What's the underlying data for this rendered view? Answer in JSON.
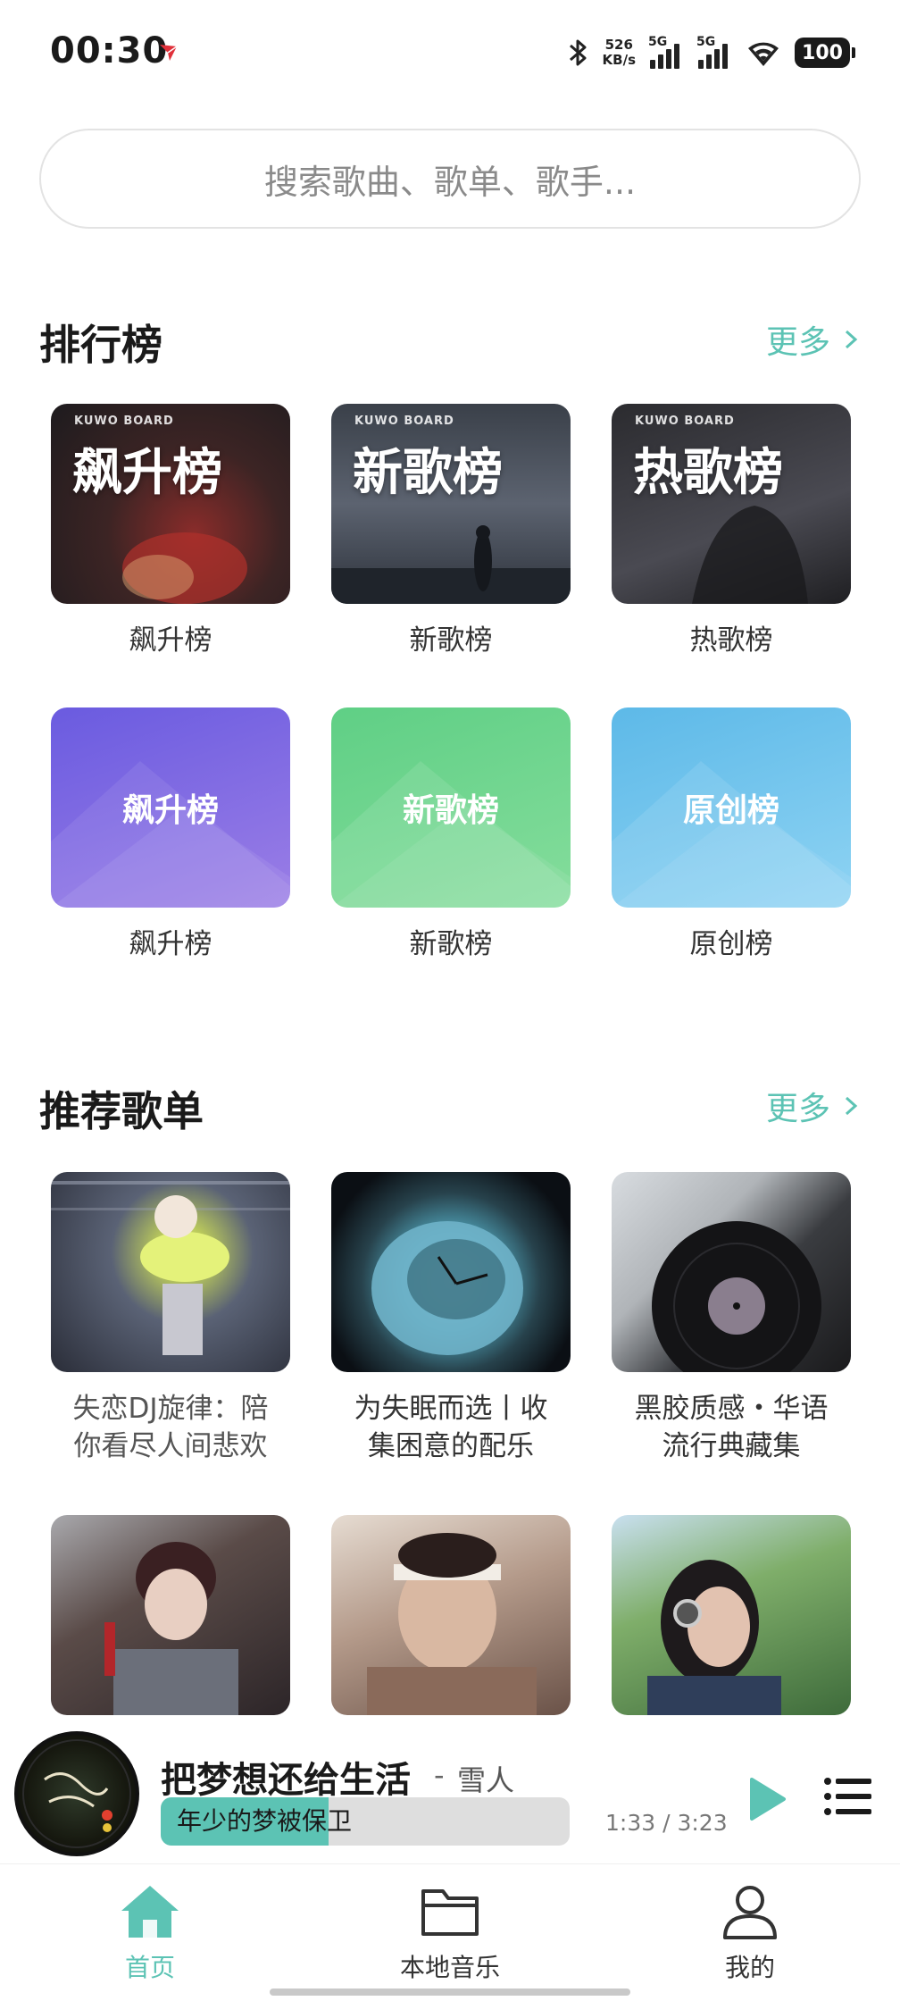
{
  "status_bar": {
    "time": "00:30",
    "net_speed_value": "526",
    "net_speed_unit": "KB/s",
    "signal1_label": "5G",
    "signal2_label": "5G",
    "battery": "100",
    "icons": [
      "bluetooth-icon",
      "signal-icon",
      "wifi-icon",
      "battery-icon"
    ]
  },
  "search": {
    "placeholder": "搜索歌曲、歌单、歌手..."
  },
  "charts_section": {
    "title": "排行榜",
    "more": "更多",
    "tiles": [
      {
        "cover_label": "飙升榜",
        "brand": "KUWO BOARD",
        "caption": "飙升榜"
      },
      {
        "cover_label": "新歌榜",
        "brand": "KUWO BOARD",
        "caption": "新歌榜"
      },
      {
        "cover_label": "热歌榜",
        "brand": "KUWO BOARD",
        "caption": "热歌榜"
      },
      {
        "cover_label": "飙升榜",
        "caption": "飙升榜"
      },
      {
        "cover_label": "新歌榜",
        "caption": "新歌榜"
      },
      {
        "cover_label": "原创榜",
        "caption": "原创榜"
      }
    ]
  },
  "playlists_section": {
    "title": "推荐歌单",
    "more": "更多",
    "items": [
      {
        "line1": "失恋DJ旋律：陪",
        "line2": "你看尽人间悲欢"
      },
      {
        "line1": "为失眠而选丨收",
        "line2": "集困意的配乐"
      },
      {
        "line1": "黑胶质感・华语",
        "line2": "流行典藏集"
      },
      {
        "line1": "",
        "line2": ""
      },
      {
        "line1": "",
        "line2": ""
      },
      {
        "line1": "",
        "line2": ""
      }
    ]
  },
  "player": {
    "song": "把梦想还给生活",
    "separator": "-",
    "artist": "雪人",
    "lyric": "年少的梦被保卫",
    "progress_fraction": 0.41,
    "time": "1:33 / 3:23"
  },
  "bottom_nav": {
    "home": "首页",
    "local": "本地音乐",
    "mine": "我的"
  },
  "colors": {
    "accent": "#5cc3b4",
    "purple_board": "#7b6be3",
    "green_board": "#6ed590",
    "blue_board": "#72c5ee"
  }
}
